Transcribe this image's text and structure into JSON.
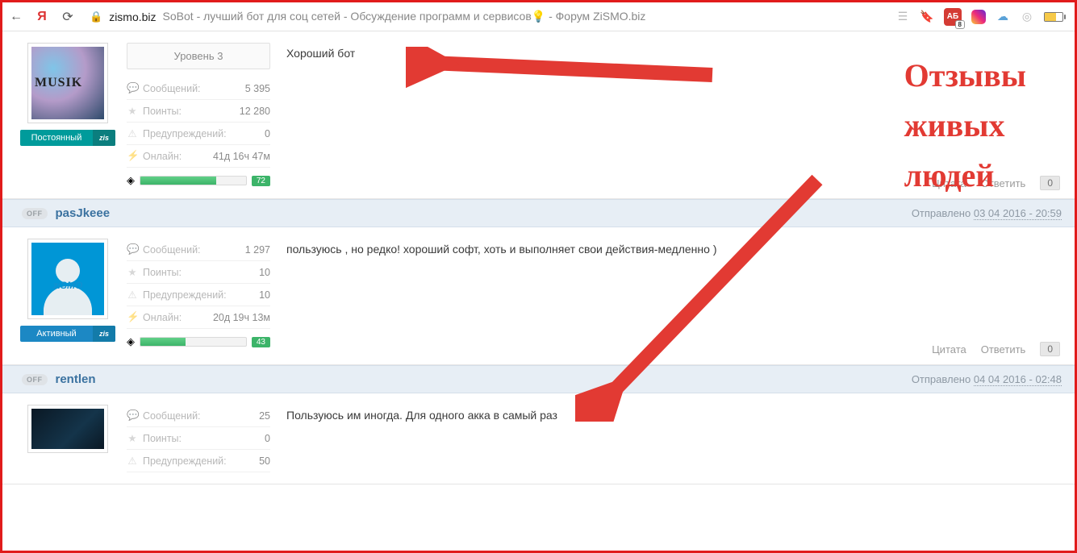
{
  "browser": {
    "domain": "zismo.biz",
    "title": "SoBot - лучший бот для соц сетей - Обсуждение программ и сервисов💡 - Форум ZiSMO.biz",
    "adblock_count": "8"
  },
  "annotation": {
    "line1": "Отзывы",
    "line2": "живых",
    "line3": "людей"
  },
  "labels": {
    "messages": "Сообщений:",
    "points": "Поинты:",
    "warnings": "Предупреждений:",
    "online": "Онлайн:",
    "quote": "Цитата",
    "reply": "Ответить",
    "sent": "Отправлено",
    "off": "OFF"
  },
  "posts": [
    {
      "level_label": "Уровень 3",
      "badge_label": "Постоянный",
      "badge_tag": "zis",
      "messages": "5 395",
      "points": "12 280",
      "warnings": "0",
      "online": "41д 16ч 47м",
      "progress": "72",
      "text": "Хороший бот",
      "reply_count": "0"
    },
    {
      "username": "pasJkeee",
      "timestamp": "03 04 2016 - 20:59",
      "badge_label": "Активный",
      "badge_tag": "zis",
      "messages": "1 297",
      "points": "10",
      "warnings": "10",
      "online": "20д 19ч 13м",
      "progress": "43",
      "text": "пользуюсь , но редко! хороший софт, хоть и выполняет свои действия-медленно )",
      "reply_count": "0"
    },
    {
      "username": "rentlen",
      "timestamp": "04 04 2016 - 02:48",
      "messages": "25",
      "points": "0",
      "warnings": "50",
      "text": "Пользуюсь им иногда. Для одного акка в самый раз"
    }
  ]
}
